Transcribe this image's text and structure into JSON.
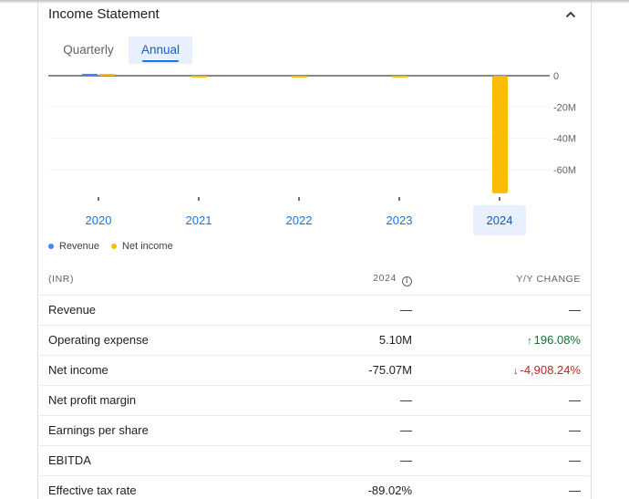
{
  "header": {
    "title": "Income Statement"
  },
  "tabs": [
    {
      "label": "Quarterly",
      "selected": false
    },
    {
      "label": "Annual",
      "selected": true
    }
  ],
  "legend": [
    {
      "label": "Revenue",
      "color": "#4285f4"
    },
    {
      "label": "Net income",
      "color": "#fbbc04"
    }
  ],
  "chart_data": {
    "type": "bar",
    "categories": [
      "2020",
      "2021",
      "2022",
      "2023",
      "2024"
    ],
    "selected_category": "2024",
    "series": [
      {
        "name": "Revenue",
        "color": "#4285f4",
        "values": [
          0.5,
          0,
          0,
          0,
          0
        ]
      },
      {
        "name": "Net income",
        "color": "#fbbc04",
        "values": [
          0.5,
          -1.2,
          -0.5,
          -1.0,
          -75.07
        ]
      }
    ],
    "ylim": [
      -78,
      0
    ],
    "yticks": [
      0,
      -20,
      -40,
      -60
    ],
    "ytick_labels": [
      "0",
      "-20M",
      "-40M",
      "-60M"
    ],
    "grid": true,
    "legend": "bottom-left"
  },
  "table": {
    "headers": {
      "label": "(INR)",
      "value": "2024",
      "change": "Y/Y CHANGE"
    },
    "rows": [
      {
        "label": "Revenue",
        "value": "—",
        "change": "—",
        "trend": "none"
      },
      {
        "label": "Operating expense",
        "value": "5.10M",
        "change": "196.08%",
        "trend": "up"
      },
      {
        "label": "Net income",
        "value": "-75.07M",
        "change": "-4,908.24%",
        "trend": "down"
      },
      {
        "label": "Net profit margin",
        "value": "—",
        "change": "—",
        "trend": "none"
      },
      {
        "label": "Earnings per share",
        "value": "—",
        "change": "—",
        "trend": "none"
      },
      {
        "label": "EBITDA",
        "value": "—",
        "change": "—",
        "trend": "none"
      },
      {
        "label": "Effective tax rate",
        "value": "-89.02%",
        "change": "—",
        "trend": "none"
      }
    ]
  }
}
